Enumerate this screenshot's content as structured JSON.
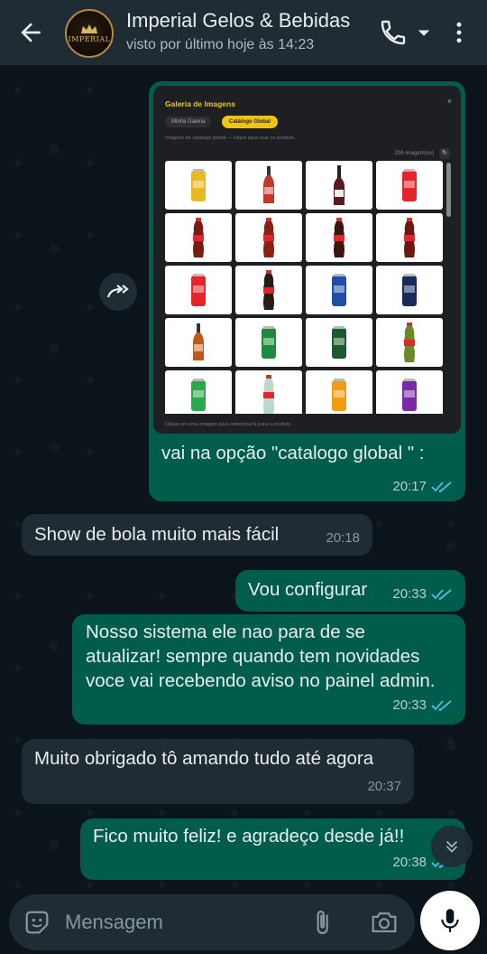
{
  "header": {
    "title": "Imperial Gelos & Bebidas",
    "status": "visto por último hoje às 14:23",
    "avatar_text": "IMPERIAL"
  },
  "image_message": {
    "screenshot": {
      "title": "Galeria de Imagens",
      "close": "×",
      "tab_mine": "Minha Galeria",
      "tab_global": "Catálogo Global",
      "subtitle": "Imagens do catálogo global — clique para usar no produto.",
      "count": "206 imagem(ns)",
      "refresh": "↻",
      "footer": "Clique em uma imagem para selecioná-la para o produto.",
      "products": [
        {
          "kind": "can",
          "color": "#e8b923"
        },
        {
          "kind": "bottle",
          "color": "#c0392b"
        },
        {
          "kind": "wine",
          "color": "#5b1a22"
        },
        {
          "kind": "can",
          "color": "#e3242b"
        },
        {
          "kind": "pet",
          "color": "#7a1a12"
        },
        {
          "kind": "pet",
          "color": "#8a1f14"
        },
        {
          "kind": "pet",
          "color": "#3b1410"
        },
        {
          "kind": "pet",
          "color": "#6b1813"
        },
        {
          "kind": "can",
          "color": "#e3242b"
        },
        {
          "kind": "pet",
          "color": "#2a1a15"
        },
        {
          "kind": "can",
          "color": "#1e4fa8"
        },
        {
          "kind": "can",
          "color": "#1a2a5a"
        },
        {
          "kind": "bottle",
          "color": "#c0581a"
        },
        {
          "kind": "can",
          "color": "#1e8a3e"
        },
        {
          "kind": "can",
          "color": "#1d5a2e"
        },
        {
          "kind": "pet",
          "color": "#6a8a2a"
        },
        {
          "kind": "can",
          "color": "#2aa84a"
        },
        {
          "kind": "pet",
          "color": "#b8d8c8"
        },
        {
          "kind": "can",
          "color": "#f39c12"
        },
        {
          "kind": "can",
          "color": "#7a2aa8"
        }
      ]
    },
    "caption": "vai na opção \"catalogo global \" :",
    "time": "20:17"
  },
  "messages": [
    {
      "text": "Show de bola muito mais fácil",
      "time": "20:18"
    },
    {
      "text": "Vou configurar",
      "time": "20:33"
    },
    {
      "text": "Nosso sistema ele nao para de se atualizar! sempre quando tem novidades voce vai recebendo aviso no painel admin.",
      "time": "20:33"
    },
    {
      "text": "Muito obrigado tô amando tudo até agora",
      "time": "20:37"
    },
    {
      "text": "Fico muito feliz! e agradeço desde já!!",
      "time": "20:38"
    }
  ],
  "composer": {
    "placeholder": "Mensagem"
  },
  "colors": {
    "outgoing": "#005c4b",
    "incoming": "#202c33",
    "header": "#1f2c34",
    "read_ticks": "#53bdeb"
  },
  "icons": [
    "back-arrow-icon",
    "phone-icon",
    "dropdown-icon",
    "more-vert-icon",
    "forward-icon",
    "emoji-icon",
    "attach-icon",
    "camera-icon",
    "mic-icon",
    "double-chevron-down-icon"
  ]
}
